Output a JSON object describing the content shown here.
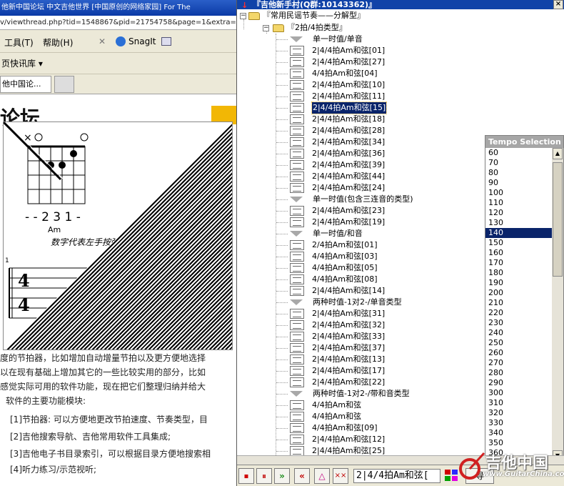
{
  "browser": {
    "title": "他新中国论坛 中文吉他世界 [中国原创的网络家园] For The",
    "address": "v/viewthread.php?tid=1548867&pid=21754758&page=1&extra=pa",
    "menu": {
      "tools": "工具(T)",
      "help": "帮助(H)",
      "snagit": "SnagIt"
    },
    "quick_links": "页快讯库 ▾",
    "tab_label": "他中国论...",
    "page_title": "论坛",
    "chord": {
      "fingering": "- - 2 3 1 -",
      "name": "Am",
      "caption": "数字代表左手按弦手指",
      "measure": "1",
      "time_top": "4",
      "time_bottom": "4"
    },
    "paragraphs": [
      "度的节拍器，比如增加自动增量节拍以及更方便地选择",
      "以在现有基础上增加其它的一些比较实用的部分，比如",
      "感觉实际可用的软件功能，现在把它们整理归纳并给大",
      "软件的主要功能模块:",
      "[1]节拍器: 可以方便地更改节拍速度、节奏类型，目",
      "[2]吉他搜索导航、吉他常用软件工具集成;",
      "[3]吉他电子书目录索引，可以根据目录方便地搜索相",
      "[4]听力练习/示范视听;"
    ]
  },
  "tree_window": {
    "title": "『吉他新手村(Q群:10143362)』",
    "close": "×",
    "root": "『常用民谣节奏——分解型』",
    "group": "『2拍/4拍类型』",
    "items": [
      {
        "type": "section",
        "label": "单一时值/单音"
      },
      {
        "type": "doc",
        "label": "2|4/4拍Am和弦[01]"
      },
      {
        "type": "doc",
        "label": "2|4/4拍Am和弦[27]"
      },
      {
        "type": "doc",
        "label": "4/4拍Am和弦[04]"
      },
      {
        "type": "doc",
        "label": "2|4/4拍Am和弦[10]"
      },
      {
        "type": "doc",
        "label": "2|4/4拍Am和弦[11]"
      },
      {
        "type": "doc",
        "label": "2|4/4拍Am和弦[15]",
        "selected": true
      },
      {
        "type": "doc",
        "label": "2|4/4拍Am和弦[18]"
      },
      {
        "type": "doc",
        "label": "2|4/4拍Am和弦[28]"
      },
      {
        "type": "doc",
        "label": "2|4/4拍Am和弦[34]"
      },
      {
        "type": "doc",
        "label": "2|4/4拍Am和弦[36]"
      },
      {
        "type": "doc",
        "label": "2|4/4拍Am和弦[39]"
      },
      {
        "type": "doc",
        "label": "2|4/4拍Am和弦[44]"
      },
      {
        "type": "doc",
        "label": "2|4/4拍Am和弦[24]"
      },
      {
        "type": "section",
        "label": "单一时值(包含三连音的类型)"
      },
      {
        "type": "doc",
        "label": "2|4/4拍Am和弦[23]"
      },
      {
        "type": "doc",
        "label": "2|4/4拍Am和弦[19]"
      },
      {
        "type": "section",
        "label": "单一时值/和音"
      },
      {
        "type": "doc",
        "label": "2/4拍Am和弦[01]"
      },
      {
        "type": "doc",
        "label": "4/4拍Am和弦[03]"
      },
      {
        "type": "doc",
        "label": "4/4拍Am和弦[05]"
      },
      {
        "type": "doc",
        "label": "4/4拍Am和弦[08]"
      },
      {
        "type": "doc",
        "label": "2|4/4拍Am和弦[14]"
      },
      {
        "type": "section",
        "label": "两种时值-1对2-/单音类型"
      },
      {
        "type": "doc",
        "label": "2|4/4拍Am和弦[31]"
      },
      {
        "type": "doc",
        "label": "2|4/4拍Am和弦[32]"
      },
      {
        "type": "doc",
        "label": "2|4/4拍Am和弦[33]"
      },
      {
        "type": "doc",
        "label": "2|4/4拍Am和弦[37]"
      },
      {
        "type": "doc",
        "label": "2|4/4拍Am和弦[13]"
      },
      {
        "type": "doc",
        "label": "2|4/4拍Am和弦[17]"
      },
      {
        "type": "doc",
        "label": "2|4/4拍Am和弦[22]"
      },
      {
        "type": "section",
        "label": "两种时值-1对2-/带和音类型"
      },
      {
        "type": "doc",
        "label": "4/4拍Am和弦"
      },
      {
        "type": "doc",
        "label": "4/4拍Am和弦"
      },
      {
        "type": "doc",
        "label": "4/4拍Am和弦[09]"
      },
      {
        "type": "doc",
        "label": "2|4/4拍Am和弦[12]"
      },
      {
        "type": "doc",
        "label": "2|4/4拍Am和弦[25]"
      }
    ]
  },
  "tempo": {
    "header": "Tempo Selection",
    "values": [
      "60",
      "70",
      "80",
      "90",
      "100",
      "110",
      "120",
      "130",
      "140",
      "150",
      "160",
      "170",
      "180",
      "190",
      "200",
      "210",
      "220",
      "230",
      "240",
      "250",
      "260",
      "270",
      "280",
      "290",
      "300",
      "310",
      "320",
      "330",
      "340",
      "350",
      "360"
    ],
    "selected": "140"
  },
  "toolbar": {
    "stop_icon": "⏹",
    "pause_icon": "⏸",
    "song_field": "2|4/4拍Am和弦[",
    "side_label": "导"
  },
  "watermark": {
    "brand": "吉他中国",
    "site": "www.GuitarChina.com"
  },
  "colors": {
    "titlebar": "#1043a8",
    "selection": "#0a246a",
    "folder": "#f3d66a"
  }
}
